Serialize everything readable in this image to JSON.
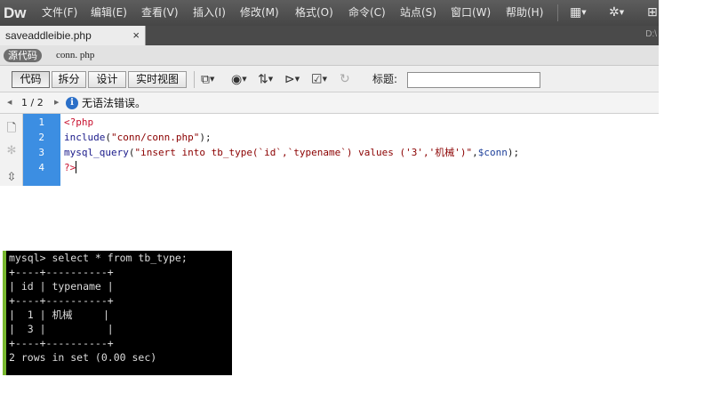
{
  "app": {
    "logo": "Dw",
    "menu": [
      "文件(F)",
      "编辑(E)",
      "查看(V)",
      "插入(I)",
      "修改(M)",
      "格式(O)",
      "命令(C)",
      "站点(S)",
      "窗口(W)",
      "帮助(H)"
    ],
    "icons": [
      "layout-icon",
      "gear-icon",
      "site-icon"
    ]
  },
  "tabs": {
    "active": "saveaddleibie.php",
    "close": "×",
    "path": "D:\\"
  },
  "related_files": {
    "source": "源代码",
    "file": "conn. php"
  },
  "toolbar": {
    "views": [
      "代码",
      "拆分",
      "设计",
      "实时视图"
    ],
    "active_view": "代码",
    "title_label": "标题:",
    "title_value": ""
  },
  "syntax": {
    "count": "1 / 2",
    "message": "无语法错误。"
  },
  "editor": {
    "line_numbers": [
      "1",
      "2",
      "3",
      "4"
    ],
    "lines": [
      [
        {
          "t": "<?php",
          "c": "tok-php"
        }
      ],
      [
        {
          "t": "include",
          "c": "tok-fn"
        },
        {
          "t": "(",
          "c": ""
        },
        {
          "t": "\"conn/conn.php\"",
          "c": "tok-str"
        },
        {
          "t": ");",
          "c": ""
        }
      ],
      [
        {
          "t": "mysql_query",
          "c": "tok-fn"
        },
        {
          "t": "(",
          "c": ""
        },
        {
          "t": "\"insert into tb_type(`id`,`typename`) values ('3','机械')\"",
          "c": "tok-str"
        },
        {
          "t": ",",
          "c": ""
        },
        {
          "t": "$conn",
          "c": "tok-var"
        },
        {
          "t": ");",
          "c": ""
        }
      ],
      [
        {
          "t": "?>",
          "c": "tok-php"
        }
      ]
    ]
  },
  "console": {
    "lines": [
      "mysql> select * from tb_type;",
      "+----+----------+",
      "| id | typename |",
      "+----+----------+",
      "|  1 | 机械     |",
      "|  3 |          |",
      "+----+----------+",
      "2 rows in set (0.00 sec)"
    ]
  }
}
